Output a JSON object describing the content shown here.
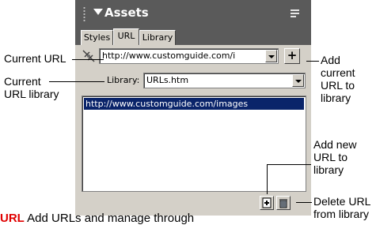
{
  "panel": {
    "title": "Assets",
    "tabs": [
      "Styles",
      "URL",
      "Library"
    ],
    "active_tab": "URL",
    "current_url": "http://www.customguide.com/images",
    "library_label": "Library:",
    "library_value": "URLs.htm",
    "list_items": [
      "http://www.customguide.com/images"
    ],
    "add_button_glyph": "+"
  },
  "callouts": {
    "current_url": "Current URL",
    "current_url_library": [
      "Current",
      "URL library"
    ],
    "add_current_url": [
      "Add current",
      "URL to",
      "library"
    ],
    "add_new_url": [
      "Add new",
      "URL to",
      "library"
    ],
    "delete_url": [
      "Delete URL",
      "from library"
    ]
  },
  "bottom_text": {
    "red": "URL",
    "rest": "   Add URLs and manage through"
  },
  "colors": {
    "panel_header": "#5a5a5a",
    "panel_face": "#d4d0c8",
    "selection": "#0a246a"
  }
}
